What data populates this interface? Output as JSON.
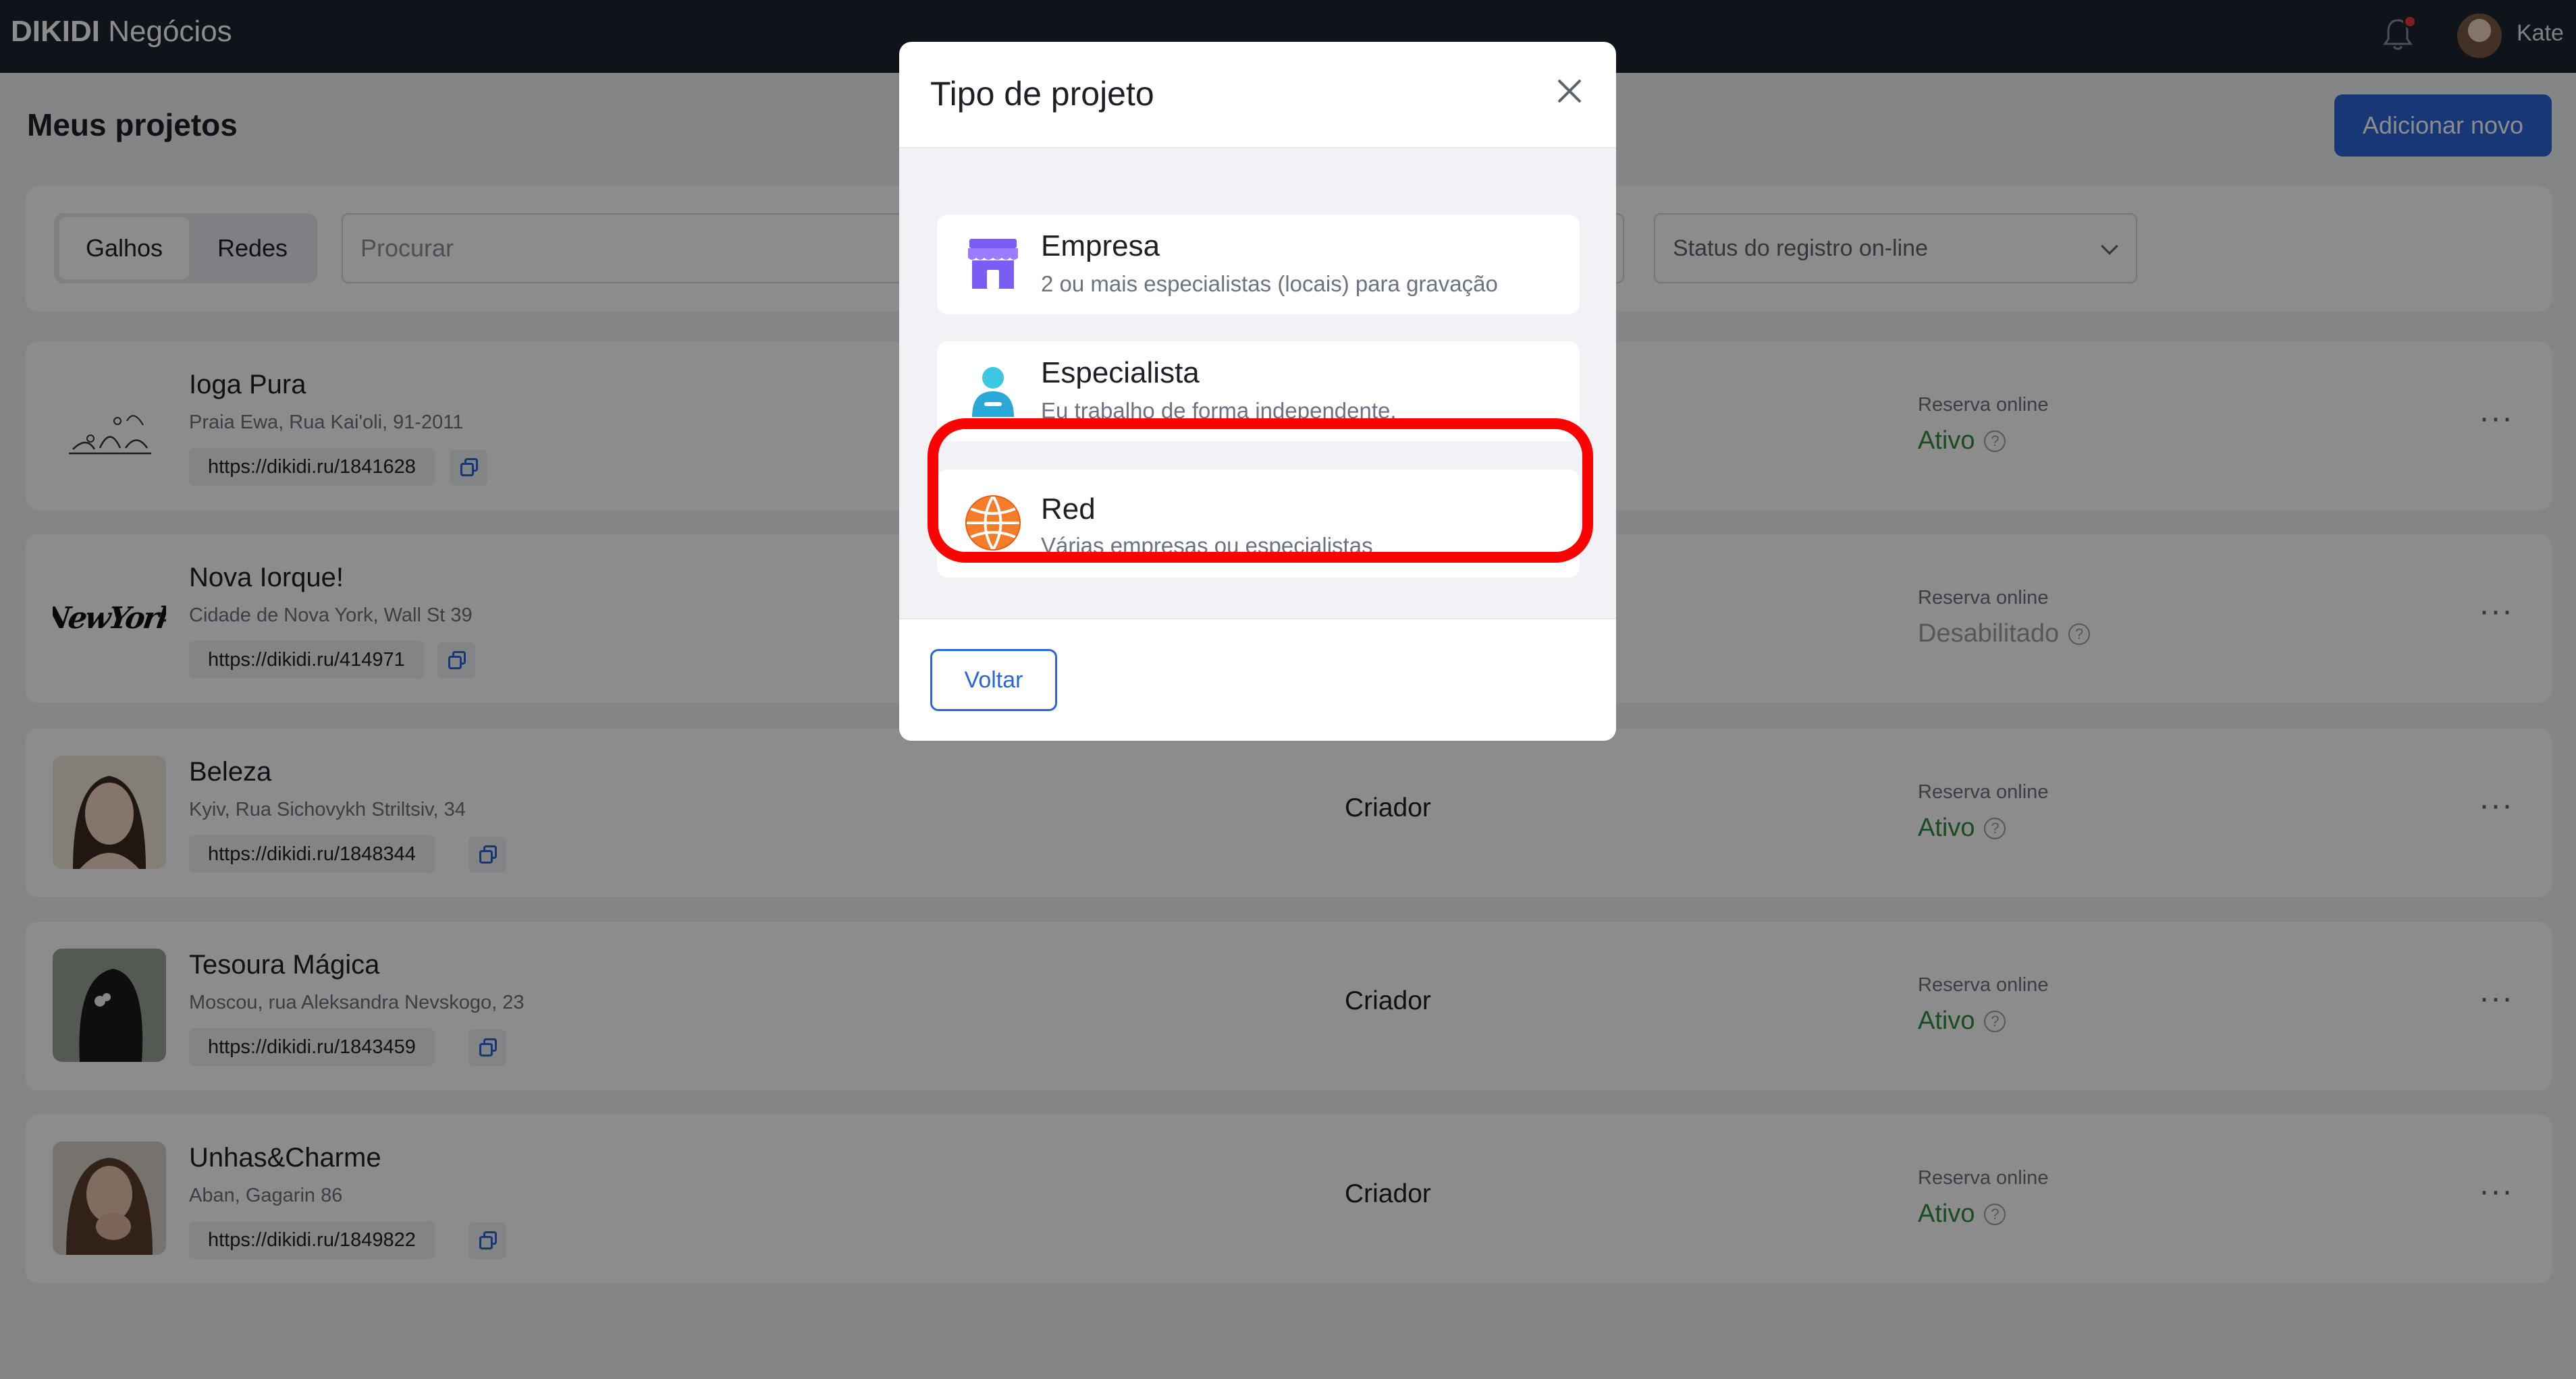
{
  "app": {
    "brand_bold": "DIKIDI",
    "brand_light": "Negócios"
  },
  "header": {
    "username": "Kate",
    "notification_icon": "bell-icon",
    "notification_badge_color": "#e53935"
  },
  "page": {
    "title": "Meus projetos",
    "add_button": "Adicionar novo"
  },
  "filters": {
    "tabs": [
      "Galhos",
      "Redes"
    ],
    "active_tab": "Galhos",
    "search_placeholder": "Procurar",
    "status_select": "Status do registro on-line"
  },
  "projects": [
    {
      "name": "Ioga Pura",
      "address": "Praia Ewa, Rua Kai'oli, 91-2011",
      "link": "https://dikidi.ru/1841628",
      "role": "",
      "reservation_label": "Reserva online",
      "reservation_status": "Ativo"
    },
    {
      "name": "Nova Iorque!",
      "address": "Cidade de Nova York, Wall St 39",
      "link": "https://dikidi.ru/414971",
      "role": "",
      "reservation_label": "Reserva online",
      "reservation_status": "Desabilitado",
      "logo_text": "NewYork"
    },
    {
      "name": "Beleza",
      "address": "Kyiv, Rua Sichovykh Striltsiv, 34",
      "link": "https://dikidi.ru/1848344",
      "role": "Criador",
      "reservation_label": "Reserva online",
      "reservation_status": "Ativo"
    },
    {
      "name": "Tesoura Mágica",
      "address": "Moscou, rua Aleksandra Nevskogo, 23",
      "link": "https://dikidi.ru/1843459",
      "role": "Criador",
      "reservation_label": "Reserva online",
      "reservation_status": "Ativo"
    },
    {
      "name": "Unhas&Charme",
      "address": "Aban, Gagarin 86",
      "link": "https://dikidi.ru/1849822",
      "role": "Criador",
      "reservation_label": "Reserva online",
      "reservation_status": "Ativo"
    }
  ],
  "modal": {
    "title": "Tipo de projeto",
    "options": [
      {
        "title": "Empresa",
        "description": "2 ou mais especialistas (locais) para gravação",
        "icon": "store-icon"
      },
      {
        "title": "Especialista",
        "description": "Eu trabalho de forma independente.",
        "icon": "person-icon"
      },
      {
        "title": "Red",
        "description": "Várias empresas ou especialistas",
        "icon": "network-globe-icon",
        "highlighted": true
      }
    ],
    "back_button": "Voltar"
  },
  "colors": {
    "accent": "#2a64d8",
    "active_status": "#2e8b3a",
    "highlight": "#ff0000",
    "topbar": "#1c2331"
  }
}
